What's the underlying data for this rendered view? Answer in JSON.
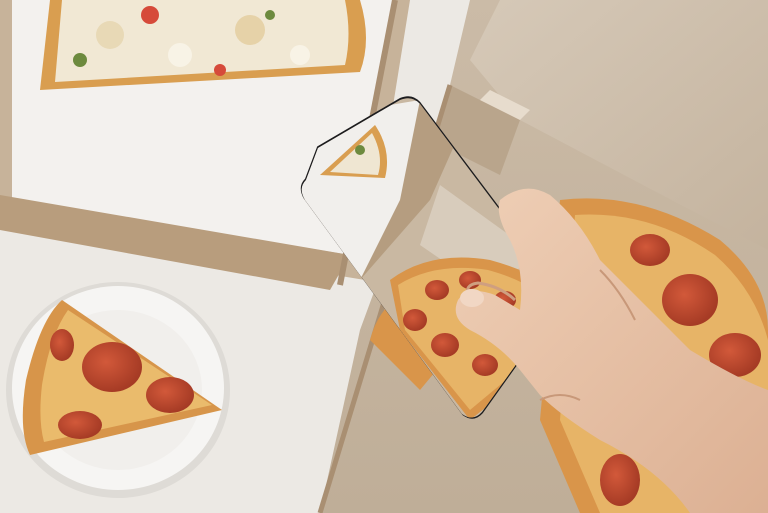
{
  "scene": {
    "colors": {
      "table": "#ece9e4",
      "box_lid": "#cdbfae",
      "box_inner": "#c9b9a5",
      "box_edge": "#a98f72",
      "paper": "#f3f1ee",
      "plate": "#f6f5f3",
      "crust": "#d79a4d",
      "cheese": "#e9b96a",
      "pepperoni": "#b8452c",
      "skin": "#e8c3a8",
      "skin_shadow": "#d4a98c",
      "phone_frame": "#1c1c1e",
      "white_pizza_topping": "#efe6d2"
    }
  }
}
